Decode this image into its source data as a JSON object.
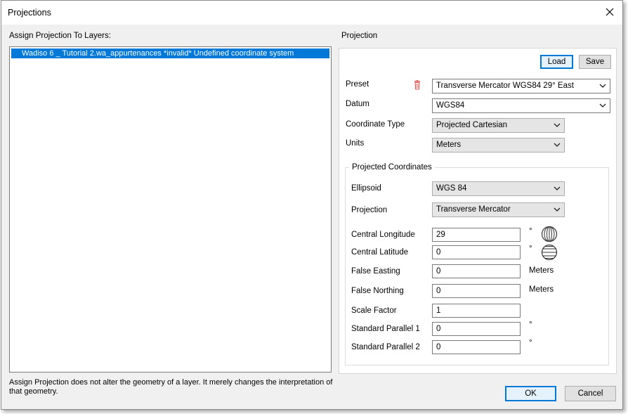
{
  "window": {
    "title": "Projections"
  },
  "left": {
    "heading": "Assign Projection To Layers:",
    "layers": [
      {
        "text": "Wadiso 6 _ Tutorial 2.wa_appurtenances *invalid*  Undefined coordinate system"
      }
    ],
    "note": "Assign Projection does not alter the geometry of a layer. It merely changes the interpretation of that geometry."
  },
  "projection": {
    "heading": "Projection",
    "load_label": "Load",
    "save_label": "Save",
    "preset_label": "Preset",
    "preset_value": "Transverse Mercator WGS84 29° East",
    "datum_label": "Datum",
    "datum_value": "WGS84",
    "coordinate_type_label": "Coordinate Type",
    "coordinate_type_value": "Projected Cartesian",
    "units_label": "Units",
    "units_value": "Meters",
    "group_title": "Projected Coordinates",
    "ellipsoid_label": "Ellipsoid",
    "ellipsoid_value": "WGS 84",
    "projection_label": "Projection",
    "projection_value": "Transverse Mercator",
    "central_longitude_label": "Central Longitude",
    "central_longitude_value": "29",
    "central_longitude_unit": "°",
    "central_latitude_label": "Central Latitude",
    "central_latitude_value": "0",
    "central_latitude_unit": "°",
    "false_easting_label": "False Easting",
    "false_easting_value": "0",
    "false_easting_unit": "Meters",
    "false_northing_label": "False Northing",
    "false_northing_value": "0",
    "false_northing_unit": "Meters",
    "scale_factor_label": "Scale Factor",
    "scale_factor_value": "1",
    "std_parallel_1_label": "Standard Parallel 1",
    "std_parallel_1_value": "0",
    "std_parallel_1_unit": "°",
    "std_parallel_2_label": "Standard Parallel 2",
    "std_parallel_2_value": "0",
    "std_parallel_2_unit": "°"
  },
  "footer": {
    "ok_label": "OK",
    "cancel_label": "Cancel"
  },
  "icons": {
    "close": "close-icon",
    "delete": "trash-icon",
    "dropdown": "chevron-down-icon",
    "longitude": "globe-longitude-icon",
    "latitude": "globe-latitude-icon"
  },
  "colors": {
    "selection": "#0078d7",
    "default_button_border": "#0078d7",
    "delete_icon": "#e05050"
  }
}
